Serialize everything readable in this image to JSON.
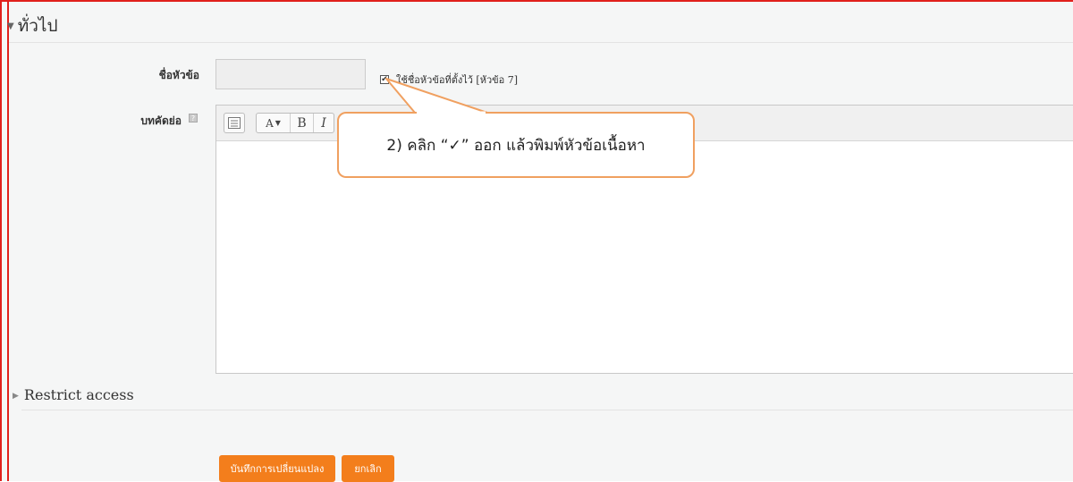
{
  "section": {
    "title": "ทั่วไป"
  },
  "form": {
    "name_label": "ชื่อหัวข้อ",
    "name_value": "",
    "use_default_label": "ใช้ชื่อหัวข้อที่ตั้งไว้ [หัวข้อ 7]",
    "use_default_checked": true,
    "summary_label": "บทคัดย่อ",
    "help_icon": "help-icon"
  },
  "editor": {
    "toolbar": {
      "toggle_icon": "toolbar-toggle-icon",
      "font_style": "A",
      "bold": "B",
      "italic": "I"
    },
    "content": ""
  },
  "callout": {
    "text": "2) คลิก “✓” ออก แล้วพิมพ์หัวข้อเนื้อหา"
  },
  "restrict": {
    "title": "Restrict access"
  },
  "buttons": {
    "save": "บันทึกการเปลี่ยนแปลง",
    "cancel": "ยกเลิก"
  },
  "colors": {
    "frame": "#e0201c",
    "accent": "#f37e1c",
    "callout_border": "#f0a060"
  }
}
